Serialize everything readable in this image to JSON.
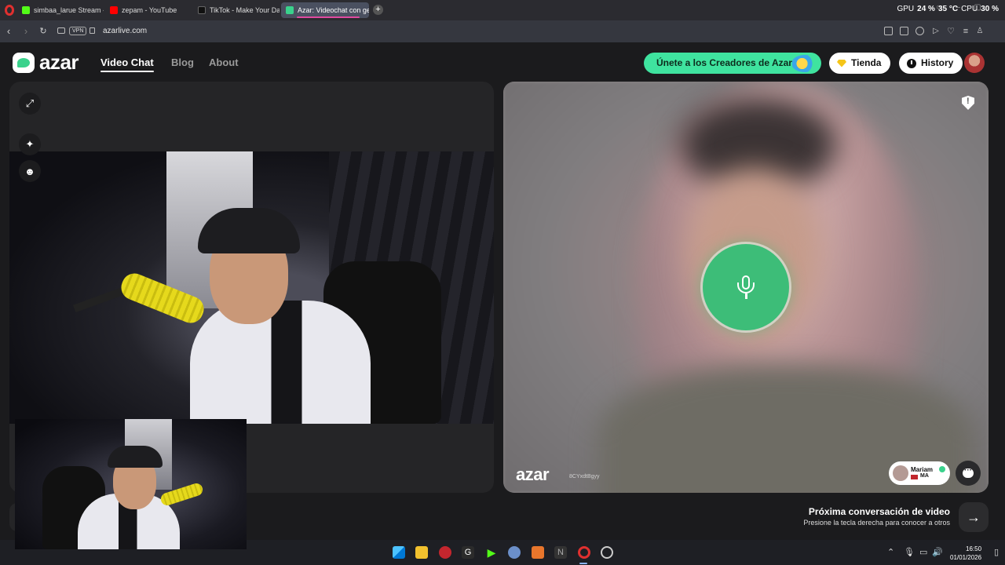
{
  "browser": {
    "tabs": [
      {
        "label": "simbaa_larue Stream - Wa",
        "favicon_color": "#53fc18"
      },
      {
        "label": "zepam - YouTube",
        "favicon_color": "#ff0000"
      },
      {
        "label": "TikTok - Make Your Day",
        "favicon_color": "#111111"
      },
      {
        "label": "Azar: Videochat con gente",
        "favicon_color": "#3ad28c",
        "active": true
      }
    ],
    "new_tab_label": "+",
    "stats": {
      "gpu_label": "GPU",
      "gpu_value": "24 %",
      "temp_value": "35 °C",
      "cpu_label": "CPU",
      "cpu_value": "30 %"
    },
    "vpn_label": "VPN",
    "url": "azarlive.com"
  },
  "header": {
    "logo": "azar",
    "nav": {
      "video_chat": "Video Chat",
      "blog": "Blog",
      "about": "About"
    },
    "creators_label": "Únete a los Creadores de Azar",
    "shop_label": "Tienda",
    "history_label": "History",
    "accent_color": "#3fe39f"
  },
  "partner": {
    "watermark_logo": "azar",
    "watermark_code": "8CYxdtBgyy",
    "name": "Mariam",
    "country": "MA",
    "mic_state": "voice-active"
  },
  "next": {
    "title": "Próxima conversación de video",
    "subtitle": "Presione la tecla derecha para conocer a otros",
    "arrow": "→"
  },
  "taskbar": {
    "time": "16:50",
    "date": "01/01/2026"
  }
}
